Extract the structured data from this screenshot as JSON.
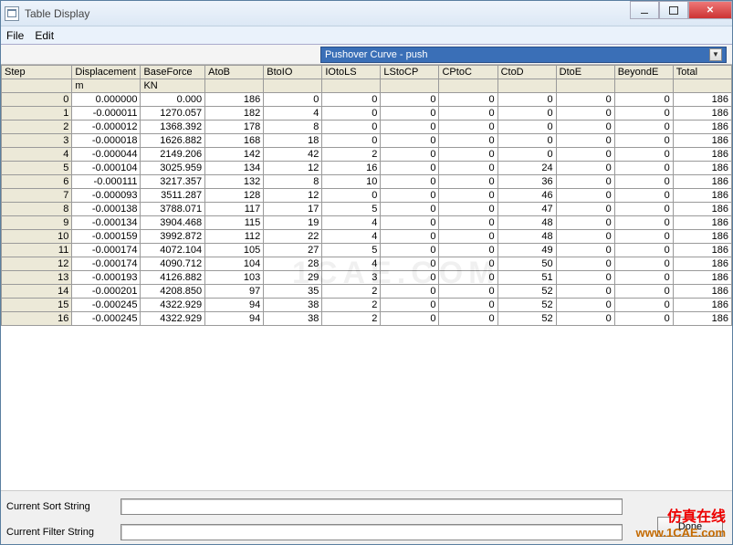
{
  "window": {
    "title": "Table Display"
  },
  "menu": {
    "file": "File",
    "edit": "Edit"
  },
  "combo": {
    "selected": "Pushover Curve - push"
  },
  "columns": [
    "Step",
    "Displacement",
    "BaseForce",
    "AtoB",
    "BtoIO",
    "IOtoLS",
    "LStoCP",
    "CPtoC",
    "CtoD",
    "DtoE",
    "BeyondE",
    "Total"
  ],
  "units": [
    "",
    "m",
    "KN",
    "",
    "",
    "",
    "",
    "",
    "",
    "",
    "",
    ""
  ],
  "rows": [
    {
      "step": 0,
      "disp": "0.000000",
      "base": "0.000",
      "a": 186,
      "b": 0,
      "c": 0,
      "d": 0,
      "e": 0,
      "f": 0,
      "g": 0,
      "h": 0,
      "t": 186
    },
    {
      "step": 1,
      "disp": "-0.000011",
      "base": "1270.057",
      "a": 182,
      "b": 4,
      "c": 0,
      "d": 0,
      "e": 0,
      "f": 0,
      "g": 0,
      "h": 0,
      "t": 186
    },
    {
      "step": 2,
      "disp": "-0.000012",
      "base": "1368.392",
      "a": 178,
      "b": 8,
      "c": 0,
      "d": 0,
      "e": 0,
      "f": 0,
      "g": 0,
      "h": 0,
      "t": 186
    },
    {
      "step": 3,
      "disp": "-0.000018",
      "base": "1626.882",
      "a": 168,
      "b": 18,
      "c": 0,
      "d": 0,
      "e": 0,
      "f": 0,
      "g": 0,
      "h": 0,
      "t": 186
    },
    {
      "step": 4,
      "disp": "-0.000044",
      "base": "2149.206",
      "a": 142,
      "b": 42,
      "c": 2,
      "d": 0,
      "e": 0,
      "f": 0,
      "g": 0,
      "h": 0,
      "t": 186
    },
    {
      "step": 5,
      "disp": "-0.000104",
      "base": "3025.959",
      "a": 134,
      "b": 12,
      "c": 16,
      "d": 0,
      "e": 0,
      "f": 24,
      "g": 0,
      "h": 0,
      "t": 186
    },
    {
      "step": 6,
      "disp": "-0.000111",
      "base": "3217.357",
      "a": 132,
      "b": 8,
      "c": 10,
      "d": 0,
      "e": 0,
      "f": 36,
      "g": 0,
      "h": 0,
      "t": 186
    },
    {
      "step": 7,
      "disp": "-0.000093",
      "base": "3511.287",
      "a": 128,
      "b": 12,
      "c": 0,
      "d": 0,
      "e": 0,
      "f": 46,
      "g": 0,
      "h": 0,
      "t": 186
    },
    {
      "step": 8,
      "disp": "-0.000138",
      "base": "3788.071",
      "a": 117,
      "b": 17,
      "c": 5,
      "d": 0,
      "e": 0,
      "f": 47,
      "g": 0,
      "h": 0,
      "t": 186
    },
    {
      "step": 9,
      "disp": "-0.000134",
      "base": "3904.468",
      "a": 115,
      "b": 19,
      "c": 4,
      "d": 0,
      "e": 0,
      "f": 48,
      "g": 0,
      "h": 0,
      "t": 186
    },
    {
      "step": 10,
      "disp": "-0.000159",
      "base": "3992.872",
      "a": 112,
      "b": 22,
      "c": 4,
      "d": 0,
      "e": 0,
      "f": 48,
      "g": 0,
      "h": 0,
      "t": 186
    },
    {
      "step": 11,
      "disp": "-0.000174",
      "base": "4072.104",
      "a": 105,
      "b": 27,
      "c": 5,
      "d": 0,
      "e": 0,
      "f": 49,
      "g": 0,
      "h": 0,
      "t": 186
    },
    {
      "step": 12,
      "disp": "-0.000174",
      "base": "4090.712",
      "a": 104,
      "b": 28,
      "c": 4,
      "d": 0,
      "e": 0,
      "f": 50,
      "g": 0,
      "h": 0,
      "t": 186
    },
    {
      "step": 13,
      "disp": "-0.000193",
      "base": "4126.882",
      "a": 103,
      "b": 29,
      "c": 3,
      "d": 0,
      "e": 0,
      "f": 51,
      "g": 0,
      "h": 0,
      "t": 186
    },
    {
      "step": 14,
      "disp": "-0.000201",
      "base": "4208.850",
      "a": 97,
      "b": 35,
      "c": 2,
      "d": 0,
      "e": 0,
      "f": 52,
      "g": 0,
      "h": 0,
      "t": 186
    },
    {
      "step": 15,
      "disp": "-0.000245",
      "base": "4322.929",
      "a": 94,
      "b": 38,
      "c": 2,
      "d": 0,
      "e": 0,
      "f": 52,
      "g": 0,
      "h": 0,
      "t": 186
    },
    {
      "step": 16,
      "disp": "-0.000245",
      "base": "4322.929",
      "a": 94,
      "b": 38,
      "c": 2,
      "d": 0,
      "e": 0,
      "f": 52,
      "g": 0,
      "h": 0,
      "t": 186
    }
  ],
  "bottom": {
    "sort_label": "Current Sort String",
    "filter_label": "Current Filter String",
    "done": "Done"
  },
  "watermark": {
    "cn": "仿真在线",
    "url": "www.1CAE.com",
    "faint": "1CAE.COM"
  }
}
